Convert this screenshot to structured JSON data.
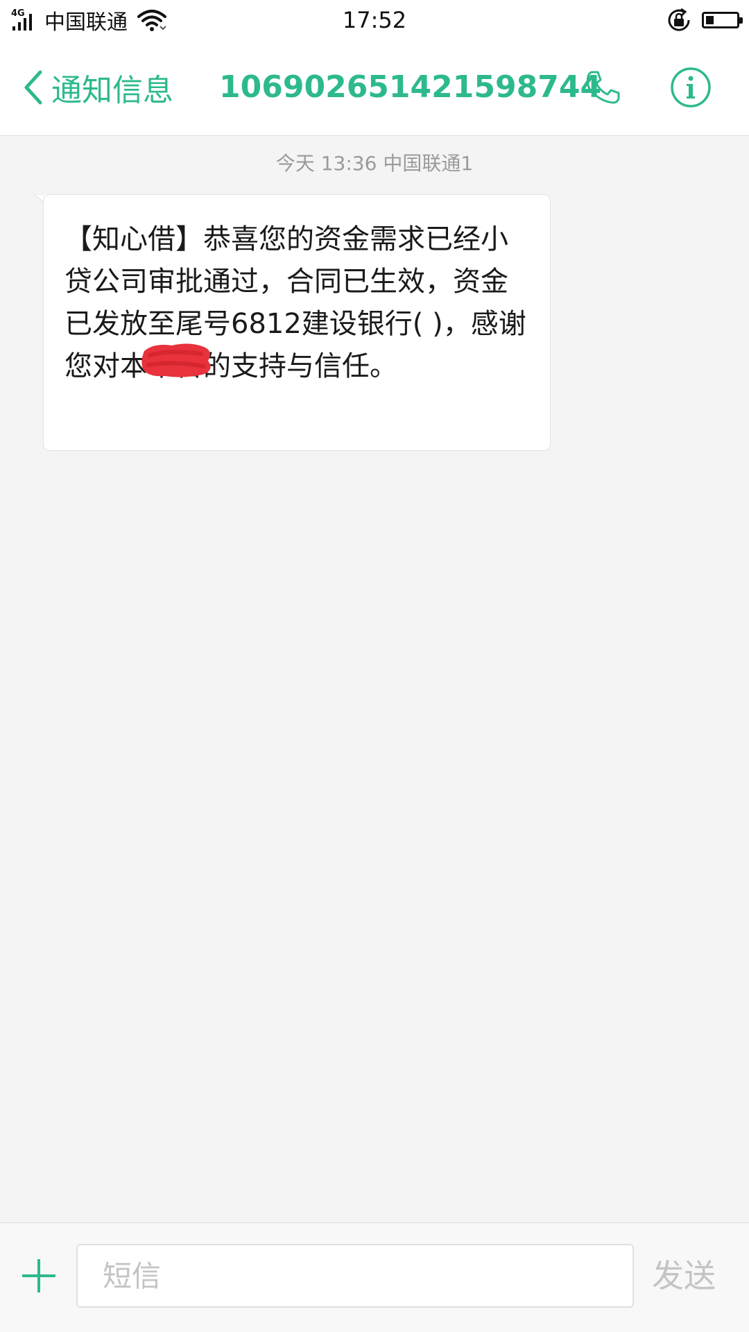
{
  "status_bar": {
    "network_type": "4G",
    "carrier": "中国联通",
    "time": "17:52",
    "icons": [
      "signal-icon",
      "wifi-icon",
      "rotation-lock-icon",
      "battery-icon"
    ],
    "battery_level": 0.25
  },
  "header": {
    "back_label": "通知信息",
    "title": "10690265142159874​4",
    "icons": [
      "chevron-left-icon",
      "phone-icon",
      "info-icon"
    ]
  },
  "conversation": {
    "meta": "今天 13:36  中国联通1",
    "messages": [
      {
        "text": "【知心借】恭喜您的资金需求已经小贷公司审批通过，合同已生效，资金已发放至尾号6812建设银行(            )，感谢您对本平台的支持与信任。"
      }
    ]
  },
  "composer": {
    "placeholder": "短信",
    "send_label": "发送",
    "icons": [
      "plus-icon"
    ]
  },
  "colors": {
    "accent": "#2db98d",
    "background": "#f4f4f4",
    "muted": "#9a9a9a",
    "redaction": "#e8323c"
  }
}
